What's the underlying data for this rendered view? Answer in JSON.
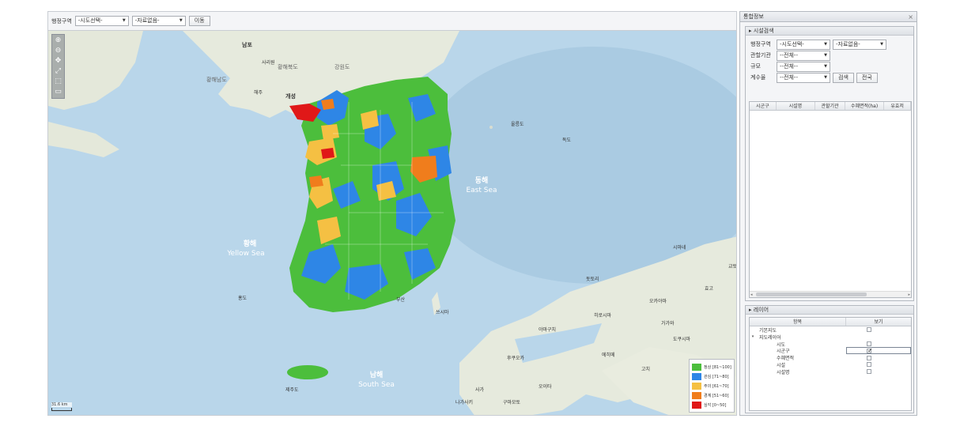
{
  "toolbar": {
    "region_label": "행정구역",
    "sido_select": "-시도선택-",
    "sigungu_select": "-자료없음-",
    "move_button": "이동"
  },
  "map_labels": {
    "yellow_sea_kr": "황해",
    "yellow_sea_en": "Yellow Sea",
    "east_sea_kr": "동해",
    "east_sea_en": "East Sea",
    "south_sea_kr": "남해",
    "south_sea_en": "South Sea",
    "gangwon_nk": "강원도",
    "hwanghae_north": "황해북도",
    "hwanghae_south": "황해남도",
    "nampo": "남포",
    "sariwon": "사리원",
    "kaesong": "개성",
    "haeju": "해주",
    "ulleungdo": "울릉도",
    "dokdo": "독도",
    "hongdo": "홍도",
    "jejudo": "제주도",
    "tsushima": "쓰시마",
    "busan": "부산",
    "japan_1": "시마네",
    "japan_2": "돗토리",
    "japan_3": "오카야마",
    "japan_4": "히로시마",
    "japan_5": "야마구치",
    "japan_6": "후쿠오카",
    "japan_7": "고치",
    "japan_8": "구마모토",
    "japan_9": "나가사키",
    "japan_10": "오이타",
    "japan_11": "에히메",
    "japan_12": "도쿠시마",
    "japan_13": "가가와",
    "japan_14": "효고",
    "japan_15": "교토",
    "japan_16": "사가"
  },
  "map_tools": [
    "zoom-in",
    "zoom-out",
    "pan",
    "full-extent",
    "select",
    "measure"
  ],
  "legend": [
    {
      "label": "정상 [81~100]",
      "color": "#4cbe3c"
    },
    {
      "label": "관심 [71~80]",
      "color": "#2e86e6"
    },
    {
      "label": "주의 [61~70]",
      "color": "#f5c043"
    },
    {
      "label": "경계 [51~60]",
      "color": "#f07d1c"
    },
    {
      "label": "심각 [0~50]",
      "color": "#e01818"
    }
  ],
  "scale": {
    "text": "31.6 km"
  },
  "panel": {
    "title": "통합정보",
    "close": "×",
    "facility_section": "시설검색",
    "form": {
      "region_label": "행정구역",
      "region_sido": "-시도선택-",
      "region_sigungu": "-자료없음-",
      "agency_label": "관할기관",
      "agency_value": "--전체--",
      "scale_label": "규모",
      "scale_value": "--전체--",
      "index_label": "계수율",
      "index_value": "--전체--",
      "search_button": "검색",
      "all_button": "전국"
    },
    "result_columns": [
      "시군구",
      "시설명",
      "관할기관",
      "수혜면적(ha)",
      "유효저"
    ],
    "layer_section": "레이어",
    "layer_columns": [
      "항목",
      "보기"
    ],
    "layers": [
      {
        "name": "기본지도",
        "indent": 0,
        "expander": "",
        "checked": false
      },
      {
        "name": "지도레이어",
        "indent": 0,
        "expander": "▾",
        "checked": null
      },
      {
        "name": "시도",
        "indent": 1,
        "expander": "",
        "checked": false
      },
      {
        "name": "시군구",
        "indent": 1,
        "expander": "",
        "checked": true
      },
      {
        "name": "수혜면적",
        "indent": 1,
        "expander": "",
        "checked": false
      },
      {
        "name": "시설",
        "indent": 1,
        "expander": "",
        "checked": false
      },
      {
        "name": "시설명",
        "indent": 1,
        "expander": "",
        "checked": false
      }
    ]
  },
  "colors": {
    "sea": "#b9d6ea",
    "land": "#e6eadd",
    "normal": "#4cbe3c",
    "interest": "#2e86e6",
    "caution": "#f5c043",
    "alert": "#f07d1c",
    "severe": "#e01818"
  }
}
